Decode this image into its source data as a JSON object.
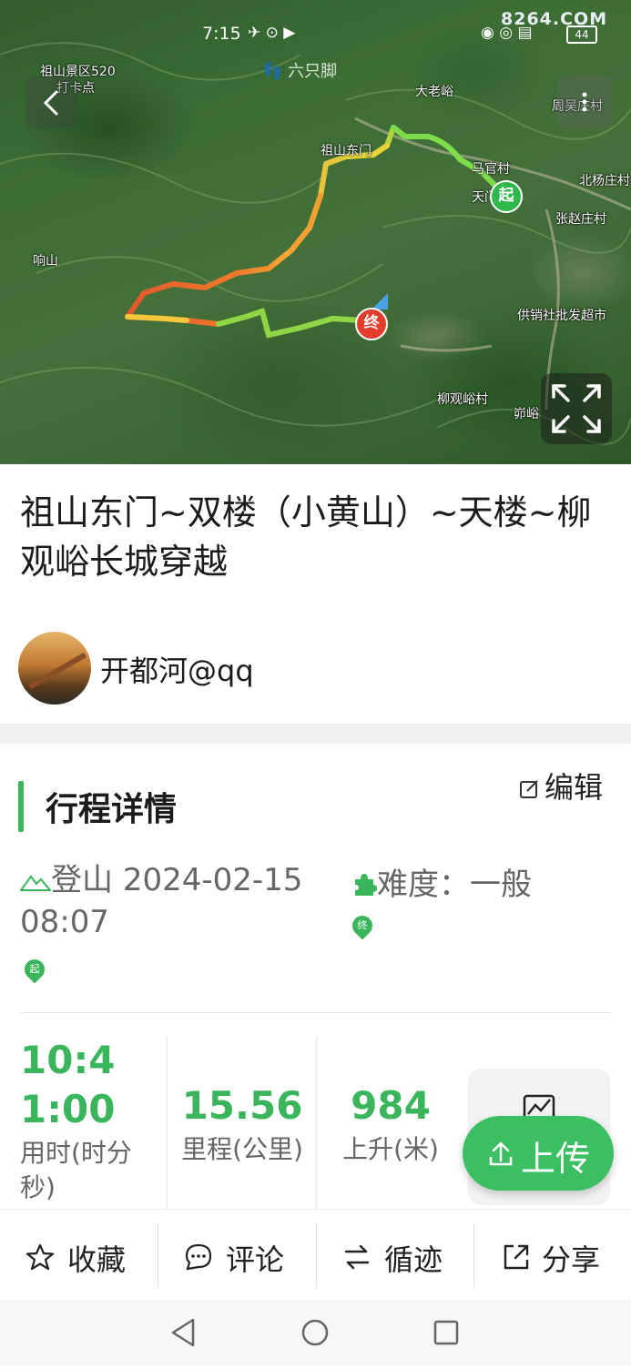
{
  "status_bar": {
    "time": "7:15",
    "left_icons": "✈ ⊙ ▶",
    "right_icons": "◉ ◎ ▤",
    "battery": "44",
    "watermark": "8264.COM"
  },
  "map": {
    "labels": {
      "zushan_scenic": "祖山景区520",
      "daka": "打卡点",
      "liuzhijiao": "六只脚",
      "dalaoyu": "大老峪",
      "zhoujiazhuang": "周吴庄村",
      "zushan_east_gate": "祖山东门",
      "mageguancun": "马官村",
      "tianmen": "天门",
      "beiyangzhuang": "北杨庄村",
      "zhangshaocun": "张赵庄村",
      "xiangshan": "响山",
      "gongxiao": "供销社批发超市",
      "liuguanyu": "柳观峪村",
      "shiyu": "峁峪"
    },
    "start_marker": "起",
    "end_marker": "终"
  },
  "trip": {
    "title": "祖山东门~双楼（小黄山）~天楼~柳观峪长城穿越",
    "author": "开都河@qq"
  },
  "details": {
    "section_title": "行程详情",
    "edit_label": "编辑",
    "activity": "登山",
    "datetime": "2024-02-15 08:07",
    "difficulty": "难度：一般",
    "pin_end": "终",
    "pin_start": "起"
  },
  "stats": [
    {
      "value": "10:41:00",
      "label": "用时(时分秒)"
    },
    {
      "value": "15.56",
      "label": "里程(公里)"
    },
    {
      "value": "984",
      "label": "上升(米)"
    }
  ],
  "upload_label": "上传",
  "actions": {
    "favorite": "收藏",
    "comment": "评论",
    "follow_track": "循迹",
    "share": "分享"
  }
}
